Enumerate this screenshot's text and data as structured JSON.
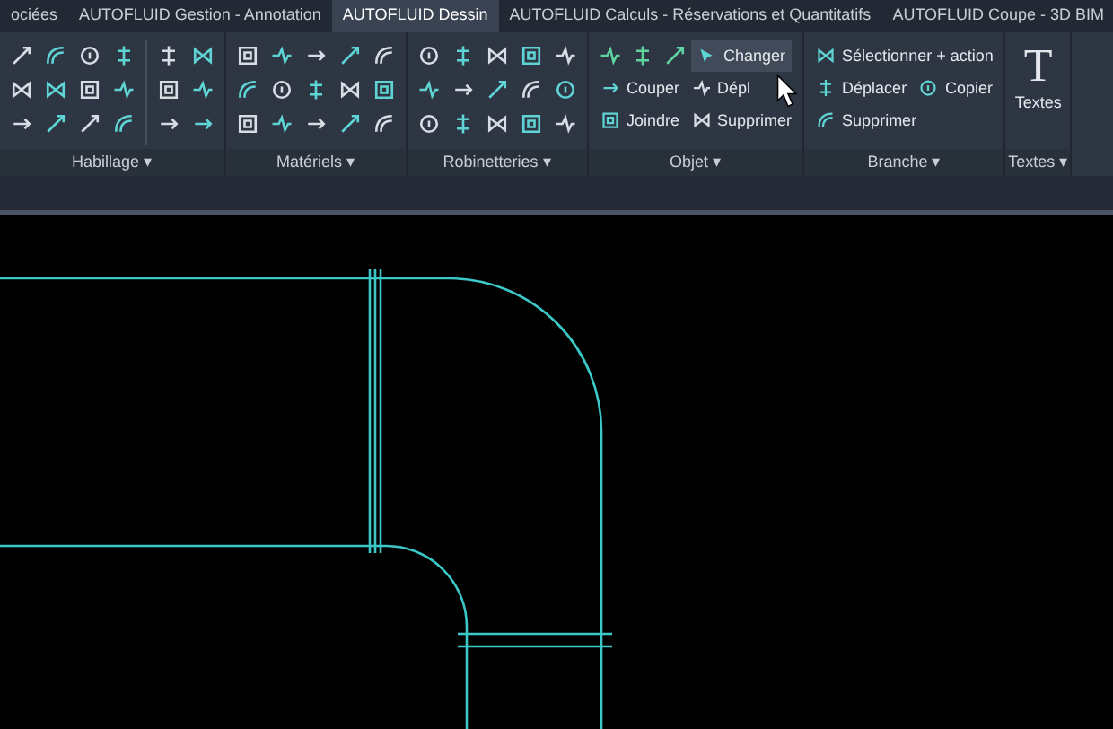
{
  "tabs": [
    {
      "label": "ociées",
      "selected": false
    },
    {
      "label": "AUTOFLUID Gestion - Annotation",
      "selected": false
    },
    {
      "label": "AUTOFLUID Dessin",
      "selected": true
    },
    {
      "label": "AUTOFLUID Calculs - Réservations et Quantitatifs",
      "selected": false
    },
    {
      "label": "AUTOFLUID Coupe - 3D BIM",
      "selected": false
    }
  ],
  "panels": [
    {
      "kind": "split-grid",
      "title": "Habillage",
      "caret": "▾"
    },
    {
      "kind": "grid",
      "title": "Matériels",
      "caret": "▾"
    },
    {
      "kind": "grid",
      "title": "Robinetteries",
      "caret": "▾"
    },
    {
      "kind": "object-buttons",
      "title": "Objet",
      "caret": "▾",
      "buttons": [
        {
          "label": "Changer",
          "hovered": true
        },
        {
          "label": "Couper",
          "hovered": false
        },
        {
          "label": "Dépl",
          "hovered": false
        },
        {
          "label": "Joindre",
          "hovered": false
        },
        {
          "label": "Supprimer",
          "hovered": false
        }
      ]
    },
    {
      "kind": "branch-buttons",
      "title": "Branche",
      "caret": "▾",
      "buttons": [
        {
          "label": "Sélectionner + action",
          "hovered": false
        },
        {
          "label": "Déplacer",
          "hovered": false
        },
        {
          "label": "Copier",
          "hovered": false
        },
        {
          "label": "Supprimer",
          "hovered": false
        }
      ]
    },
    {
      "kind": "big",
      "title": "Textes",
      "caret": "▾",
      "glyph": "T",
      "label": "Textes"
    }
  ]
}
